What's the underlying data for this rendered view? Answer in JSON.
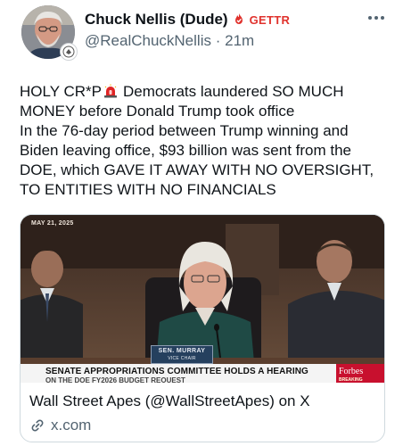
{
  "author": {
    "display_name": "Chuck Nellis (Dude)",
    "platform": "GETTR",
    "handle": "@RealChuckNellis",
    "separator": "·",
    "time_ago": "21m",
    "verified_icon": "flame-badge-icon"
  },
  "menu": {
    "icon": "more-options-icon"
  },
  "post": {
    "line1_before_emoji": "HOLY CR*P",
    "emoji": "police-siren-icon",
    "line1_after_emoji": "Democrats laundered SO MUCH MONEY before Donald Trump took office",
    "line2": "In the 76-day period between Trump winning and Biden leaving office, $93 billion was sent from the DOE, which GAVE IT AWAY WITH NO OVERSIGHT, TO ENTITIES WITH NO FINANCIALS"
  },
  "card": {
    "media": {
      "date_stamp": "MAY 21, 2025",
      "nameplate_name": "SEN. MURRAY",
      "nameplate_title": "VICE CHAIR",
      "lower_third": "SENATE APPROPRIATIONS COMMITTEE HOLDS A HEARING",
      "lower_third_sub": "ON THE DOE FY2026 BUDGET REQUEST",
      "brand": "Forbes",
      "brand_sub": "BREAKING"
    },
    "title": "Wall Street Apes (@WallStreetApes) on X",
    "domain": "x.com",
    "link_icon": "link-icon"
  },
  "colors": {
    "text_primary": "#0f1419",
    "text_secondary": "#536471",
    "gettr_red": "#e0322d",
    "card_border": "#cfd9de"
  }
}
